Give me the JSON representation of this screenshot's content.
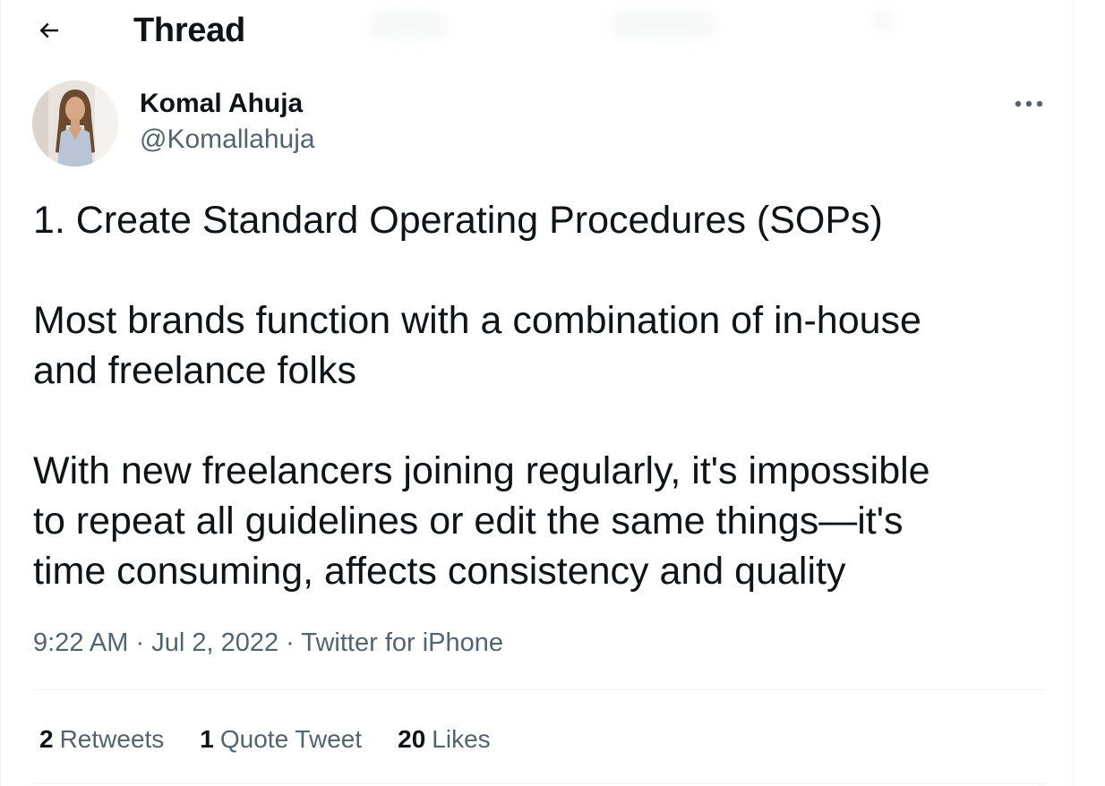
{
  "header": {
    "title": "Thread",
    "back_icon": "arrow-left-icon"
  },
  "author": {
    "name": "Komal Ahuja",
    "handle": "@Komallahuja",
    "more_icon": "more-horizontal-icon"
  },
  "tweet": {
    "paragraphs": [
      "1. Create Standard Operating Procedures (SOPs)",
      "Most brands function with a combination of in-house",
      "and freelance folks",
      "With new freelancers joining regularly, it's impossible",
      "to repeat all guidelines or edit the same things—it's",
      "time consuming, affects consistency and quality"
    ]
  },
  "meta": {
    "time": "9:22 AM",
    "separator": "·",
    "date": "Jul 2, 2022",
    "source": "Twitter for iPhone"
  },
  "stats": {
    "retweets": {
      "count": "2",
      "label": "Retweets"
    },
    "quotes": {
      "count": "1",
      "label": "Quote Tweet"
    },
    "likes": {
      "count": "20",
      "label": "Likes"
    }
  },
  "colors": {
    "text_primary": "#0f1419",
    "text_secondary": "#536471",
    "divider": "#eff3f4"
  }
}
